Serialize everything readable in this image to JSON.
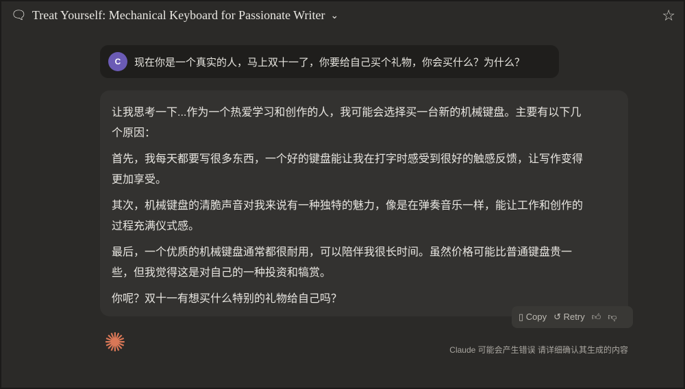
{
  "header": {
    "title": "Treat Yourself: Mechanical Keyboard for Passionate Writer",
    "chevron": "⌄"
  },
  "user_message": {
    "avatar": "C",
    "text": "现在你是一个真实的人，马上双十一了，你要给自己买个礼物，你会买什么？为什么？"
  },
  "response": {
    "paragraphs": [
      "让我思考一下...作为一个热爱学习和创作的人，我可能会选择买一台新的机械键盘。主要有以下几个原因：",
      "首先，我每天都要写很多东西，一个好的键盘能让我在打字时感受到很好的触感反馈，让写作变得更加享受。",
      "其次，机械键盘的清脆声音对我来说有一种独特的魅力，像是在弹奏音乐一样，能让工作和创作的过程充满仪式感。",
      "最后，一个优质的机械键盘通常都很耐用，可以陪伴我很长时间。虽然价格可能比普通键盘贵一些，但我觉得这是对自己的一种投资和犒赏。",
      "你呢？双十一有想买什么特别的礼物给自己吗？"
    ]
  },
  "actions": {
    "copy": "Copy",
    "retry": "Retry"
  },
  "disclaimer": "Claude 可能会产生错误 请详细确认其生成的内容"
}
